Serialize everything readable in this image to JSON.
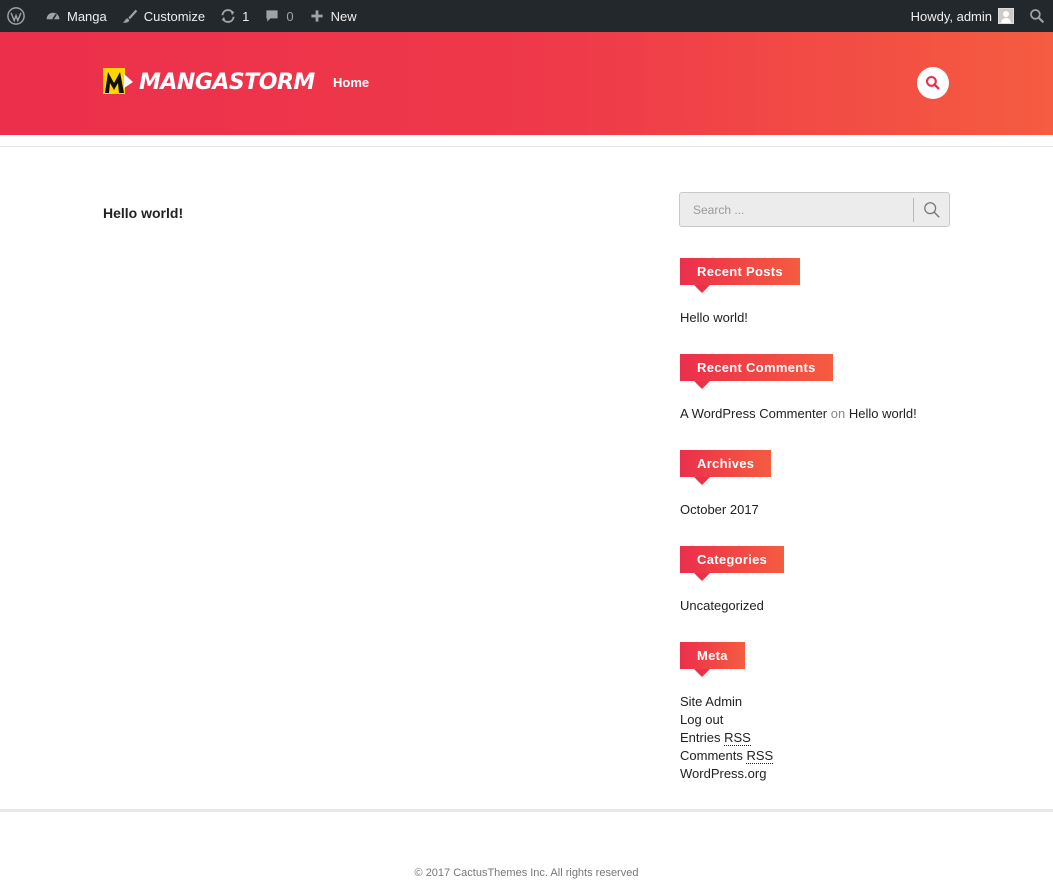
{
  "adminbar": {
    "site_name": "Manga",
    "customize": "Customize",
    "updates_count": "1",
    "comments_count": "0",
    "new_label": "New",
    "greeting": "Howdy, admin"
  },
  "header": {
    "logo_text": "MANGASTORM",
    "nav_home": "Home"
  },
  "main": {
    "post_title": "Hello world!"
  },
  "sidebar": {
    "search_placeholder": "Search ...",
    "recent_posts": {
      "title": "Recent Posts",
      "items": [
        "Hello world!"
      ]
    },
    "recent_comments": {
      "title": "Recent Comments",
      "author": "A WordPress Commenter",
      "on": "on",
      "post": "Hello world!"
    },
    "archives": {
      "title": "Archives",
      "items": [
        "October 2017"
      ]
    },
    "categories": {
      "title": "Categories",
      "items": [
        "Uncategorized"
      ]
    },
    "meta": {
      "title": "Meta",
      "site_admin": "Site Admin",
      "log_out": "Log out",
      "entries": "Entries",
      "comments": "Comments",
      "rss": "RSS",
      "wordpress_org": "WordPress.org"
    }
  },
  "footer": {
    "copyright": "© 2017 CactusThemes Inc. All rights reserved"
  },
  "colors": {
    "accent_start": "#ec2f4b",
    "accent_end": "#f55c40",
    "adminbar_bg": "#23282d"
  }
}
